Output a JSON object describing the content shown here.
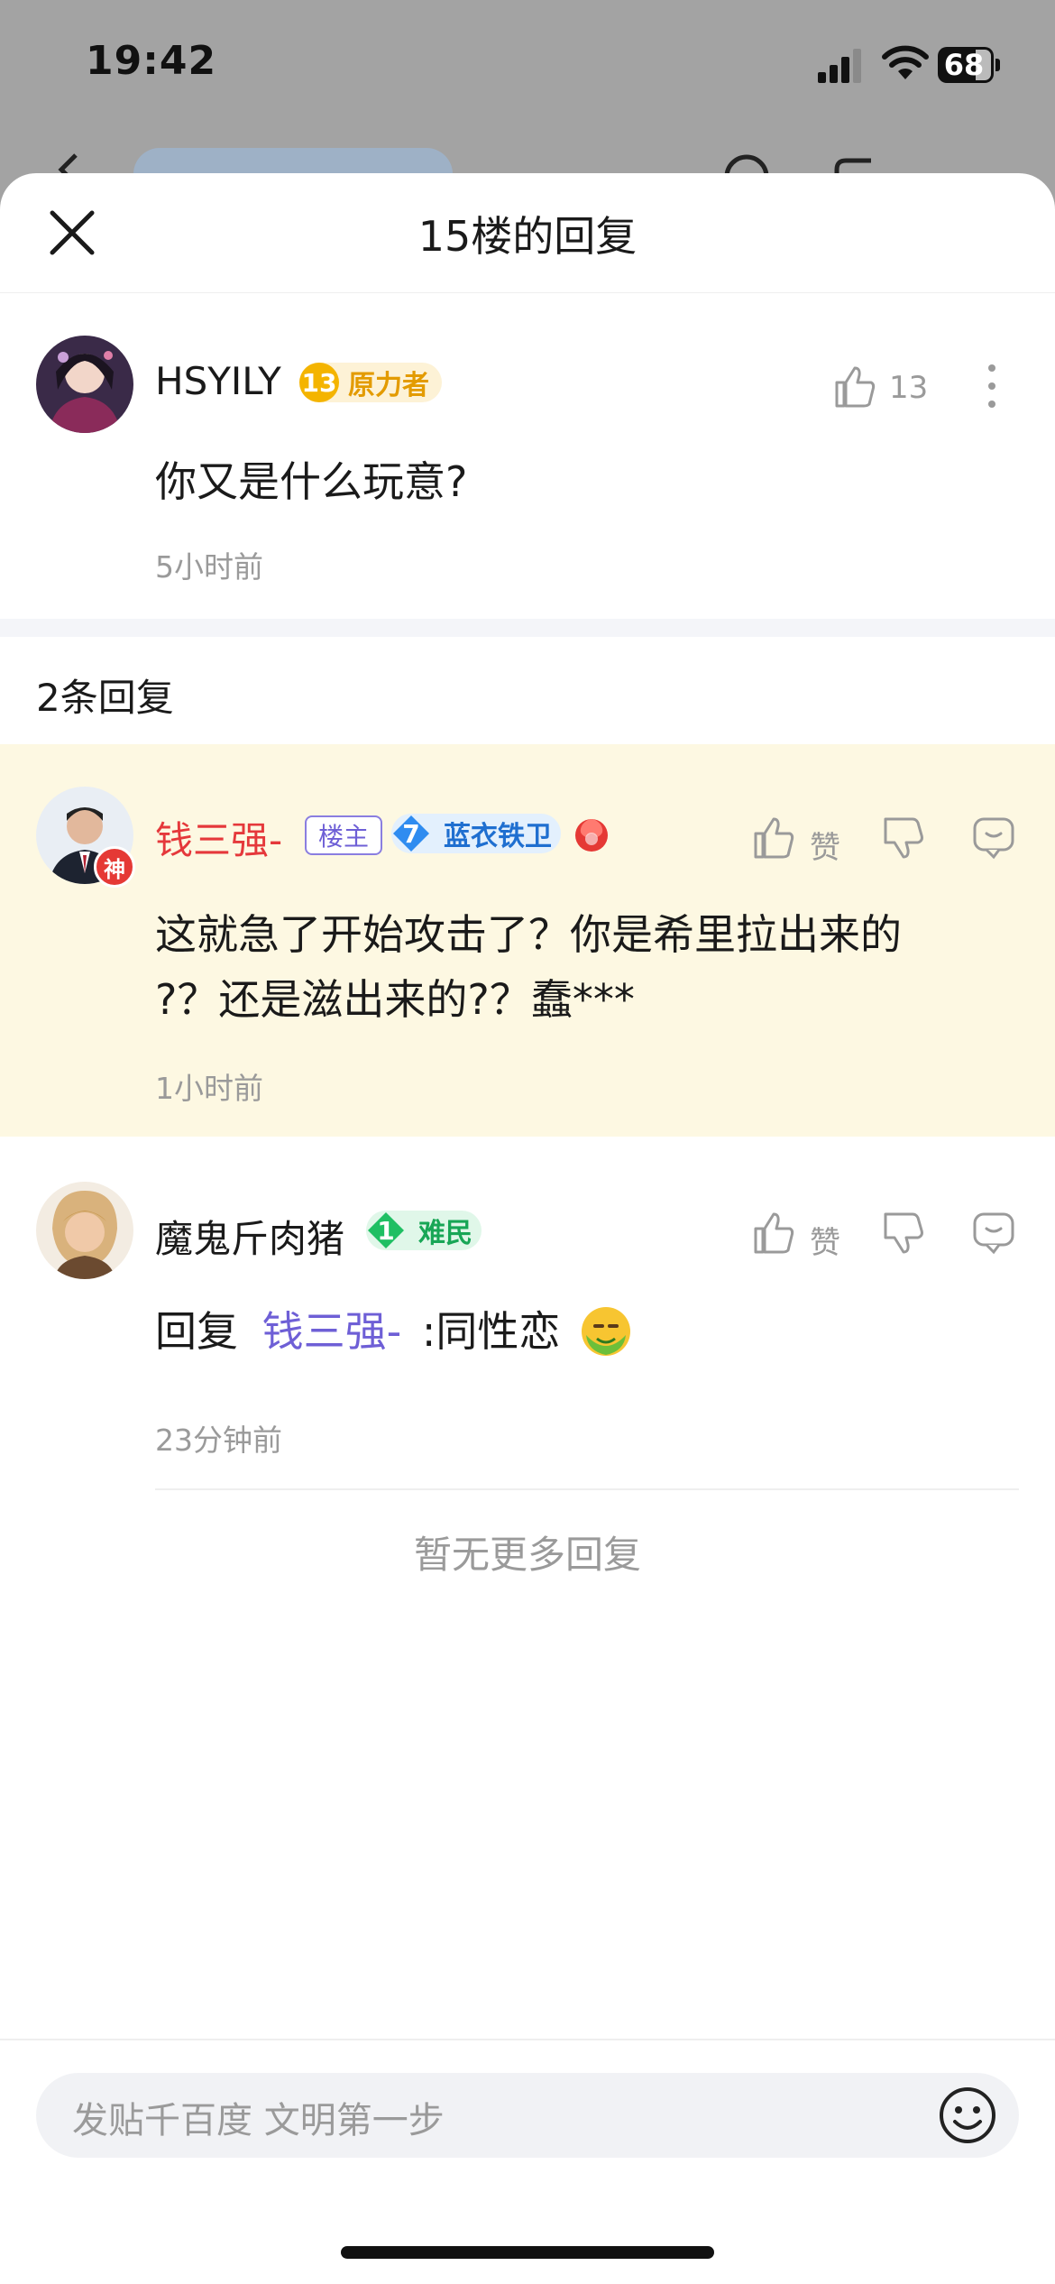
{
  "status": {
    "time": "19:42",
    "battery": "68"
  },
  "sheet": {
    "title": "15楼的回复",
    "close_icon": "close-icon"
  },
  "main_comment": {
    "username": "HSYILY",
    "level": "13",
    "badge": "原力者",
    "likes": "13",
    "text": "你又是什么玩意?",
    "time": "5小时前"
  },
  "replies_header": "2条回复",
  "replies": [
    {
      "username": "钱三强-",
      "owner_tag": "楼主",
      "level": "7",
      "badge": "蓝衣铁卫",
      "avatar_badge": "神",
      "like_label": "赞",
      "text_line1": "这就急了开始攻击了？你是希里拉出来的",
      "text_line2": "?？还是滋出来的?？蠢***",
      "time": "1小时前"
    },
    {
      "username": "魔鬼斤肉猪",
      "level": "1",
      "badge": "难民",
      "like_label": "赞",
      "reply_prefix": "回复",
      "reply_to": "钱三强-",
      "text": ":同性恋",
      "time": "23分钟前"
    }
  ],
  "no_more": "暂无更多回复",
  "input": {
    "placeholder": "发贴千百度 文明第一步"
  },
  "colors": {
    "highlight_bg": "#fdf8e2",
    "owner_name": "#e5383b",
    "reply_link": "#6e5fd6",
    "gold_badge": "#f4a800",
    "blue_badge": "#2f8cf0",
    "green_badge": "#1fbf63"
  }
}
